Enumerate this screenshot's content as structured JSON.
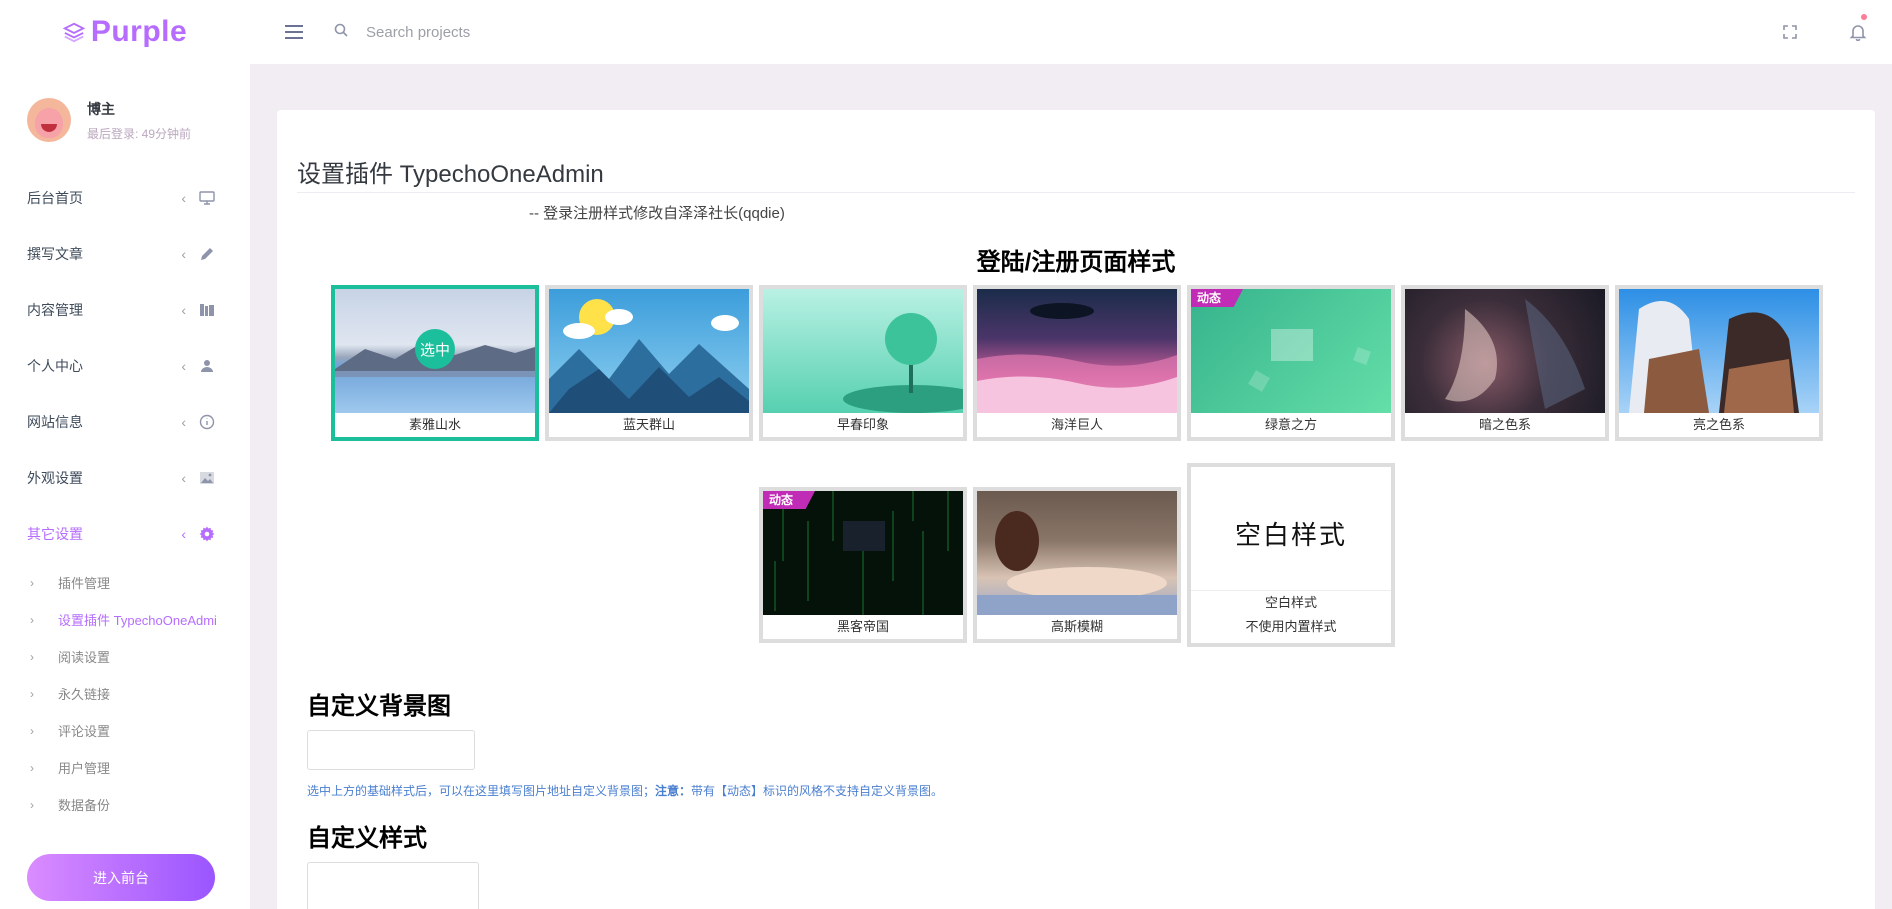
{
  "brand": {
    "name": "Purple",
    "accent": "#b66dff"
  },
  "search": {
    "placeholder": "Search projects"
  },
  "profile": {
    "name": "博主",
    "last_login": "最后登录: 49分钟前"
  },
  "nav": {
    "items": [
      {
        "label": "后台首页",
        "icon": "monitor-icon"
      },
      {
        "label": "撰写文章",
        "icon": "pencil-icon"
      },
      {
        "label": "内容管理",
        "icon": "book-icon"
      },
      {
        "label": "个人中心",
        "icon": "user-icon"
      },
      {
        "label": "网站信息",
        "icon": "info-icon"
      },
      {
        "label": "外观设置",
        "icon": "image-icon"
      },
      {
        "label": "其它设置",
        "icon": "gear-icon"
      }
    ],
    "sub_items": [
      {
        "label": "插件管理"
      },
      {
        "label": "设置插件 TypechoOneAdmin"
      },
      {
        "label": "阅读设置"
      },
      {
        "label": "永久链接"
      },
      {
        "label": "评论设置"
      },
      {
        "label": "用户管理"
      },
      {
        "label": "数据备份"
      }
    ],
    "front_button": "进入前台"
  },
  "page": {
    "title": "设置插件 TypechoOneAdmin",
    "subtitle": "-- 登录注册样式修改自泽泽社长(qqdie)",
    "style_section_title": "登陆/注册页面样式",
    "styles": [
      {
        "name": "素雅山水",
        "selected": true,
        "selected_label": "选中"
      },
      {
        "name": "蓝天群山"
      },
      {
        "name": "早春印象"
      },
      {
        "name": "海洋巨人"
      },
      {
        "name": "绿意之方",
        "badge": "动态"
      },
      {
        "name": "暗之色系"
      },
      {
        "name": "亮之色系"
      },
      {
        "name": "黑客帝国",
        "badge": "动态"
      },
      {
        "name": "高斯模糊"
      },
      {
        "name": "空白样式",
        "note": "不使用内置样式",
        "preview_text": "空白样式"
      }
    ],
    "bg_section_title": "自定义背景图",
    "bg_input_value": "",
    "hint_prefix": "选中上方的基础样式后，可以在这里填写图片地址自定义背景图；",
    "hint_bold": "注意：",
    "hint_suffix": "带有【动态】标识的风格不支持自定义背景图。",
    "css_section_title": "自定义样式",
    "css_input_value": ""
  },
  "colors": {
    "selected_border": "#1bbf9b",
    "badge": "#c02cb5",
    "hint": "#4a7fd0"
  }
}
